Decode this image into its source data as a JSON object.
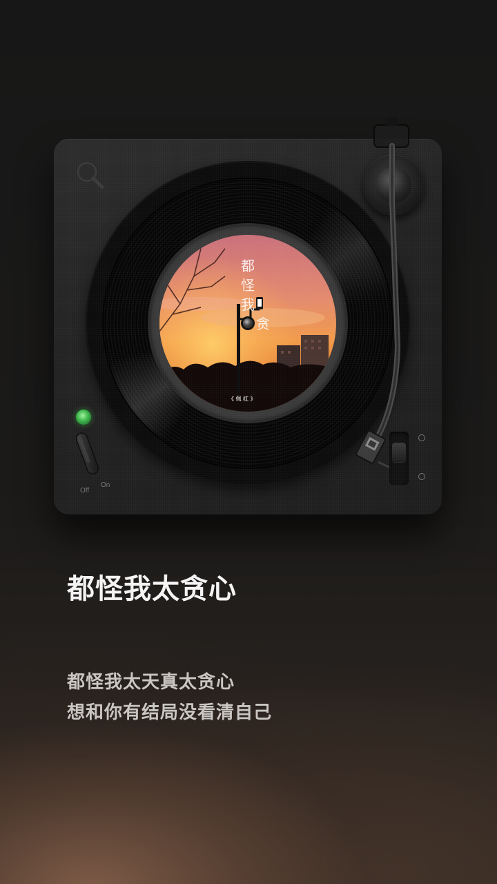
{
  "song": {
    "title": "都怪我太贪心"
  },
  "lyrics": {
    "lines": [
      "都怪我太天真太贪心",
      "想和你有结局没看清自己"
    ]
  },
  "player": {
    "power_switch": {
      "off_label": "Off",
      "on_label": "On",
      "state": "on"
    },
    "album_cover": {
      "title_text": "都怪我太贪心",
      "artist_text": "《 佩 红 》"
    },
    "icons": {
      "loupe": "magnifier-icon",
      "led": "power-led-icon"
    },
    "colors": {
      "led": "#3bb34a",
      "title": "#f4f4f4",
      "lyrics": "#c9c6c3",
      "sky_top": "#e89a7a",
      "sky_glow": "#ff9a3a"
    }
  }
}
